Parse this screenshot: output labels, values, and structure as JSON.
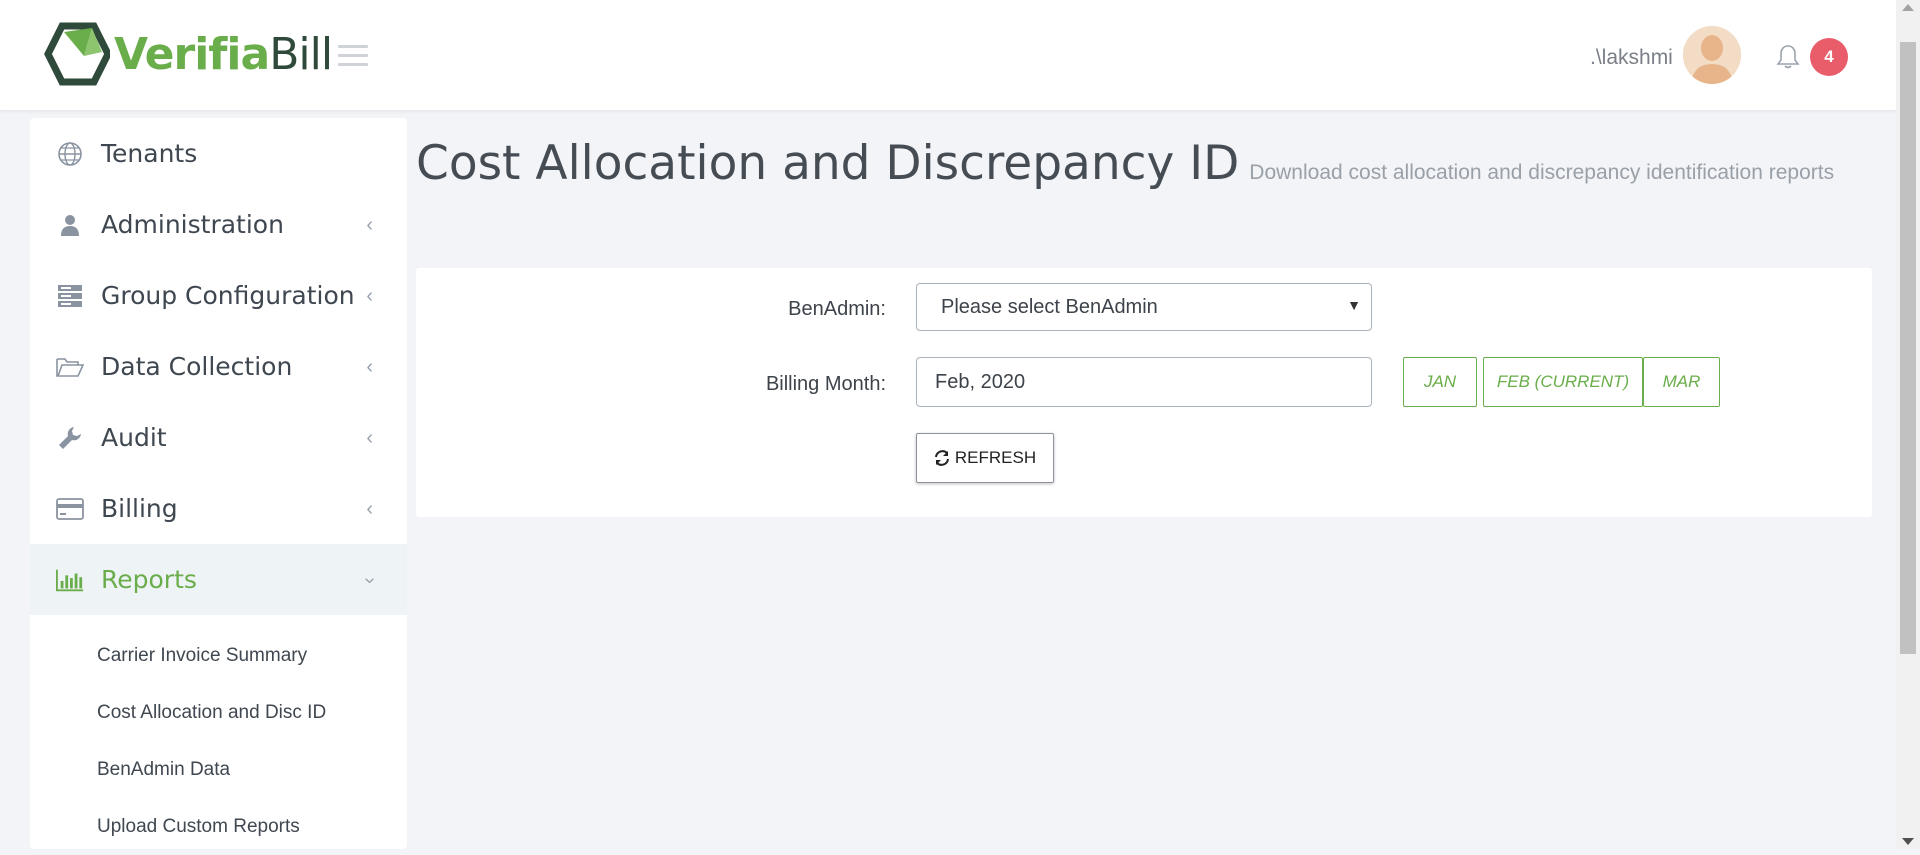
{
  "header": {
    "logo_part1": "Verifia",
    "logo_part2": "Bill",
    "username": ".\\lakshmi",
    "notification_count": "4"
  },
  "sidebar": {
    "items": [
      {
        "label": "Tenants",
        "icon": "globe-icon",
        "expandable": false
      },
      {
        "label": "Administration",
        "icon": "user-icon",
        "expandable": true
      },
      {
        "label": "Group Configuration",
        "icon": "server-icon",
        "expandable": true
      },
      {
        "label": "Data Collection",
        "icon": "folder-open-icon",
        "expandable": true
      },
      {
        "label": "Audit",
        "icon": "wrench-icon",
        "expandable": true
      },
      {
        "label": "Billing",
        "icon": "credit-card-icon",
        "expandable": true
      },
      {
        "label": "Reports",
        "icon": "bar-chart-icon",
        "expandable": true,
        "active": true
      }
    ],
    "sub_items": [
      "Carrier Invoice Summary",
      "Cost Allocation and Disc ID",
      "BenAdmin Data",
      "Upload Custom Reports"
    ]
  },
  "page": {
    "title": "Cost Allocation and Discrepancy ID",
    "subtitle": "Download cost allocation and discrepancy identification reports"
  },
  "form": {
    "benadmin_label": "BenAdmin:",
    "benadmin_value": "Please select BenAdmin",
    "billing_month_label": "Billing Month:",
    "billing_month_value": "Feb, 2020",
    "month_buttons": [
      "JAN",
      "FEB (CURRENT)",
      "MAR"
    ],
    "refresh_label": "REFRESH"
  },
  "colors": {
    "accent": "#6aad4b",
    "badge": "#e95c6a",
    "background": "#f3f4f7"
  }
}
